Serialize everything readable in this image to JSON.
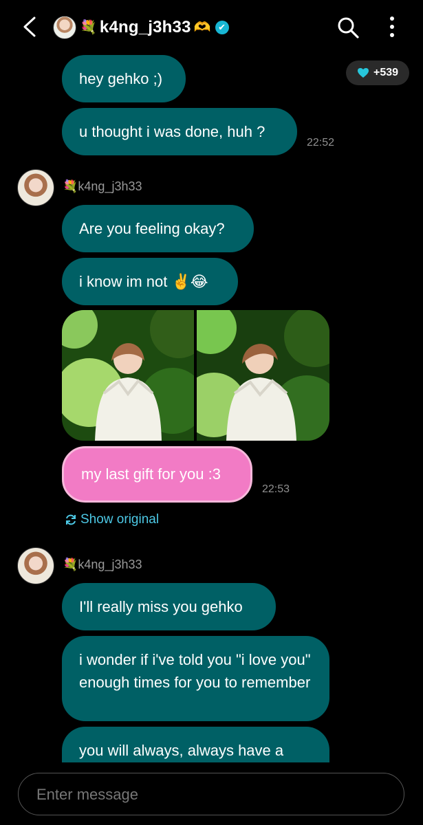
{
  "header": {
    "title_prefix_emoji": "💐",
    "title": "k4ng_j3h33",
    "title_suffix_emoji": "🫶",
    "verified_mark": "✔",
    "search_icon": "search-icon",
    "more_icon": "more-icon"
  },
  "points": {
    "icon": "heart-icon",
    "value": "+539"
  },
  "messages": [
    {
      "text": "hey gehko ;)"
    },
    {
      "text": "u thought i was done, huh ?",
      "time": "22:52"
    },
    {
      "sender": "💐k4ng_j3h33",
      "text": "Are you feeling okay?"
    },
    {
      "text": "i know im not ✌️😂"
    },
    {
      "text": "my last gift for you :3",
      "time": "22:53"
    },
    {
      "sender": "💐k4ng_j3h33",
      "text": "I'll really miss you gehko"
    },
    {
      "text": "i wonder if i've told you \"i love you\" enough times for you to remember"
    },
    {
      "text": "you will always, always have a"
    }
  ],
  "show_original": "Show original",
  "composer": {
    "placeholder": "Enter message"
  },
  "colors": {
    "message_bubble": "#006065",
    "highlight_bubble": "#f27bc5",
    "link": "#4dc9e6"
  }
}
